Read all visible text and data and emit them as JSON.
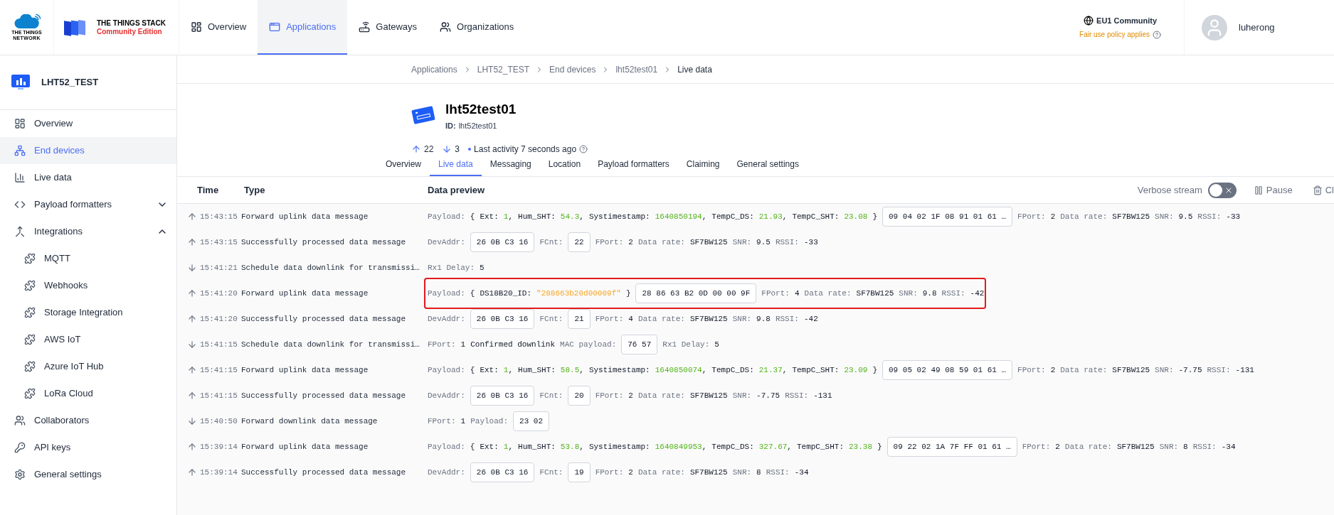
{
  "topbar": {
    "brand_line1": "THE THINGS",
    "brand_line2": "NETWORK",
    "product": "THE THINGS STACK",
    "edition": "Community Edition",
    "nav": [
      {
        "label": "Overview",
        "selected": false
      },
      {
        "label": "Applications",
        "selected": true
      },
      {
        "label": "Gateways",
        "selected": false
      },
      {
        "label": "Organizations",
        "selected": false
      }
    ],
    "cluster": "EU1 Community",
    "fair_use": "Fair use policy applies",
    "user": "luherong"
  },
  "sidebar": {
    "title": "LHT52_TEST",
    "items": [
      {
        "label": "Overview",
        "selected": false
      },
      {
        "label": "End devices",
        "selected": true
      },
      {
        "label": "Live data",
        "selected": false
      },
      {
        "label": "Payload formatters",
        "selected": false,
        "expanded": false
      },
      {
        "label": "Integrations",
        "selected": false,
        "expanded": true,
        "children": [
          {
            "label": "MQTT",
            "selected": false
          },
          {
            "label": "Webhooks",
            "selected": false
          },
          {
            "label": "Storage Integration",
            "selected": false
          },
          {
            "label": "AWS IoT",
            "selected": false
          },
          {
            "label": "Azure IoT Hub",
            "selected": false
          },
          {
            "label": "LoRa Cloud",
            "selected": false
          }
        ]
      },
      {
        "label": "Collaborators",
        "selected": false
      },
      {
        "label": "API keys",
        "selected": false
      },
      {
        "label": "General settings",
        "selected": false
      }
    ]
  },
  "breadcrumbs": [
    "Applications",
    "LHT52_TEST",
    "End devices",
    "lht52test01",
    "Live data"
  ],
  "device": {
    "name": "lht52test01",
    "id_label": "ID:",
    "id": "lht52test01",
    "uplinks": "22",
    "downlinks": "3",
    "activity": "Last activity 7 seconds ago"
  },
  "tabs": [
    {
      "label": "Overview",
      "selected": false
    },
    {
      "label": "Live data",
      "selected": true
    },
    {
      "label": "Messaging",
      "selected": false
    },
    {
      "label": "Location",
      "selected": false
    },
    {
      "label": "Payload formatters",
      "selected": false
    },
    {
      "label": "Claiming",
      "selected": false
    },
    {
      "label": "General settings",
      "selected": false
    }
  ],
  "table": {
    "columns": [
      "Time",
      "Type",
      "Data preview"
    ],
    "toolbar": {
      "verbose_label": "Verbose stream",
      "verbose_on": false,
      "pause": "Pause",
      "clear": "Cl"
    },
    "rows": [
      {
        "kind": "uplink",
        "time": "15:43:15",
        "type": "Forward uplink data message",
        "highlighted": false,
        "preview": [
          {
            "kind": "label",
            "text": "Payload:"
          },
          {
            "kind": "json",
            "open": "{",
            "close": "}",
            "fields": [
              {
                "key": "Ext:",
                "value": "1",
                "kind": "number",
                "sep": ","
              },
              {
                "key": "Hum_SHT:",
                "value": "54.3",
                "kind": "number",
                "sep": ","
              },
              {
                "key": "Systimestamp:",
                "value": "1640850194",
                "kind": "number",
                "sep": ","
              },
              {
                "key": "TempC_DS:",
                "value": "21.93",
                "kind": "number",
                "sep": ","
              },
              {
                "key": "TempC_SHT:",
                "value": "23.08",
                "kind": "number"
              }
            ]
          },
          {
            "kind": "box",
            "text": "09 04 02 1F 08 91 01 61 …"
          },
          {
            "kind": "label",
            "text": "FPort:"
          },
          {
            "kind": "value",
            "text": "2"
          },
          {
            "kind": "label",
            "text": "Data rate:"
          },
          {
            "kind": "value",
            "text": "SF7BW125"
          },
          {
            "kind": "label",
            "text": "SNR:"
          },
          {
            "kind": "value",
            "text": "9.5"
          },
          {
            "kind": "label",
            "text": "RSSI:"
          },
          {
            "kind": "value",
            "text": "-33"
          }
        ]
      },
      {
        "kind": "uplink",
        "time": "15:43:15",
        "type": "Successfully processed data message",
        "highlighted": false,
        "preview": [
          {
            "kind": "label",
            "text": "DevAddr:"
          },
          {
            "kind": "box",
            "text": "26 0B C3 16"
          },
          {
            "kind": "label",
            "text": "FCnt:"
          },
          {
            "kind": "box",
            "text": "22"
          },
          {
            "kind": "label",
            "text": "FPort:"
          },
          {
            "kind": "value",
            "text": "2"
          },
          {
            "kind": "label",
            "text": "Data rate:"
          },
          {
            "kind": "value",
            "text": "SF7BW125"
          },
          {
            "kind": "label",
            "text": "SNR:"
          },
          {
            "kind": "value",
            "text": "9.5"
          },
          {
            "kind": "label",
            "text": "RSSI:"
          },
          {
            "kind": "value",
            "text": "-33"
          }
        ]
      },
      {
        "kind": "downlink",
        "time": "15:41:21",
        "type": "Schedule data downlink for transmissi…",
        "highlighted": false,
        "preview": [
          {
            "kind": "label",
            "text": "Rx1 Delay:"
          },
          {
            "kind": "value",
            "text": "5"
          }
        ]
      },
      {
        "kind": "uplink",
        "time": "15:41:20",
        "type": "Forward uplink data message",
        "highlighted": true,
        "preview": [
          {
            "kind": "label",
            "text": "Payload:"
          },
          {
            "kind": "json",
            "open": "{",
            "close": "}",
            "fields": [
              {
                "key": "DS18B20_ID:",
                "value": "\"288663b20d00009f\"",
                "kind": "string"
              }
            ]
          },
          {
            "kind": "box",
            "text": "28 86 63 B2 0D 00 00 9F"
          },
          {
            "kind": "label",
            "text": "FPort:"
          },
          {
            "kind": "value",
            "text": "4"
          },
          {
            "kind": "label",
            "text": "Data rate:"
          },
          {
            "kind": "value",
            "text": "SF7BW125"
          },
          {
            "kind": "label",
            "text": "SNR:"
          },
          {
            "kind": "value",
            "text": "9.8"
          },
          {
            "kind": "label",
            "text": "RSSI:"
          },
          {
            "kind": "value",
            "text": "-42"
          }
        ]
      },
      {
        "kind": "uplink",
        "time": "15:41:20",
        "type": "Successfully processed data message",
        "highlighted": false,
        "preview": [
          {
            "kind": "label",
            "text": "DevAddr:"
          },
          {
            "kind": "box",
            "text": "26 0B C3 16"
          },
          {
            "kind": "label",
            "text": "FCnt:"
          },
          {
            "kind": "box",
            "text": "21"
          },
          {
            "kind": "label",
            "text": "FPort:"
          },
          {
            "kind": "value",
            "text": "4"
          },
          {
            "kind": "label",
            "text": "Data rate:"
          },
          {
            "kind": "value",
            "text": "SF7BW125"
          },
          {
            "kind": "label",
            "text": "SNR:"
          },
          {
            "kind": "value",
            "text": "9.8"
          },
          {
            "kind": "label",
            "text": "RSSI:"
          },
          {
            "kind": "value",
            "text": "-42"
          }
        ]
      },
      {
        "kind": "downlink",
        "time": "15:41:15",
        "type": "Schedule data downlink for transmissi…",
        "highlighted": false,
        "preview": [
          {
            "kind": "label",
            "text": "FPort:"
          },
          {
            "kind": "value",
            "text": "1"
          },
          {
            "kind": "value",
            "text": "Confirmed downlink"
          },
          {
            "kind": "label",
            "text": "MAC payload:"
          },
          {
            "kind": "box",
            "text": "76 57"
          },
          {
            "kind": "label",
            "text": "Rx1 Delay:"
          },
          {
            "kind": "value",
            "text": "5"
          }
        ]
      },
      {
        "kind": "uplink",
        "time": "15:41:15",
        "type": "Forward uplink data message",
        "highlighted": false,
        "preview": [
          {
            "kind": "label",
            "text": "Payload:"
          },
          {
            "kind": "json",
            "open": "{",
            "close": "}",
            "fields": [
              {
                "key": "Ext:",
                "value": "1",
                "kind": "number",
                "sep": ","
              },
              {
                "key": "Hum_SHT:",
                "value": "58.5",
                "kind": "number",
                "sep": ","
              },
              {
                "key": "Systimestamp:",
                "value": "1640850074",
                "kind": "number",
                "sep": ","
              },
              {
                "key": "TempC_DS:",
                "value": "21.37",
                "kind": "number",
                "sep": ","
              },
              {
                "key": "TempC_SHT:",
                "value": "23.09",
                "kind": "number"
              }
            ]
          },
          {
            "kind": "box",
            "text": "09 05 02 49 08 59 01 61 …"
          },
          {
            "kind": "label",
            "text": "FPort:"
          },
          {
            "kind": "value",
            "text": "2"
          },
          {
            "kind": "label",
            "text": "Data rate:"
          },
          {
            "kind": "value",
            "text": "SF7BW125"
          },
          {
            "kind": "label",
            "text": "SNR:"
          },
          {
            "kind": "value",
            "text": "-7.75"
          },
          {
            "kind": "label",
            "text": "RSSI:"
          },
          {
            "kind": "value",
            "text": "-131"
          }
        ]
      },
      {
        "kind": "uplink",
        "time": "15:41:15",
        "type": "Successfully processed data message",
        "highlighted": false,
        "preview": [
          {
            "kind": "label",
            "text": "DevAddr:"
          },
          {
            "kind": "box",
            "text": "26 0B C3 16"
          },
          {
            "kind": "label",
            "text": "FCnt:"
          },
          {
            "kind": "box",
            "text": "20"
          },
          {
            "kind": "label",
            "text": "FPort:"
          },
          {
            "kind": "value",
            "text": "2"
          },
          {
            "kind": "label",
            "text": "Data rate:"
          },
          {
            "kind": "value",
            "text": "SF7BW125"
          },
          {
            "kind": "label",
            "text": "SNR:"
          },
          {
            "kind": "value",
            "text": "-7.75"
          },
          {
            "kind": "label",
            "text": "RSSI:"
          },
          {
            "kind": "value",
            "text": "-131"
          }
        ]
      },
      {
        "kind": "downlink",
        "time": "15:40:50",
        "type": "Forward downlink data message",
        "highlighted": false,
        "preview": [
          {
            "kind": "label",
            "text": "FPort:"
          },
          {
            "kind": "value",
            "text": "1"
          },
          {
            "kind": "label",
            "text": "Payload:"
          },
          {
            "kind": "box",
            "text": "23 02"
          }
        ]
      },
      {
        "kind": "uplink",
        "time": "15:39:14",
        "type": "Forward uplink data message",
        "highlighted": false,
        "preview": [
          {
            "kind": "label",
            "text": "Payload:"
          },
          {
            "kind": "json",
            "open": "{",
            "close": "}",
            "fields": [
              {
                "key": "Ext:",
                "value": "1",
                "kind": "number",
                "sep": ","
              },
              {
                "key": "Hum_SHT:",
                "value": "53.8",
                "kind": "number",
                "sep": ","
              },
              {
                "key": "Systimestamp:",
                "value": "1640849953",
                "kind": "number",
                "sep": ","
              },
              {
                "key": "TempC_DS:",
                "value": "327.67",
                "kind": "number",
                "sep": ","
              },
              {
                "key": "TempC_SHT:",
                "value": "23.38",
                "kind": "number"
              }
            ]
          },
          {
            "kind": "box",
            "text": "09 22 02 1A 7F FF 01 61 …"
          },
          {
            "kind": "label",
            "text": "FPort:"
          },
          {
            "kind": "value",
            "text": "2"
          },
          {
            "kind": "label",
            "text": "Data rate:"
          },
          {
            "kind": "value",
            "text": "SF7BW125"
          },
          {
            "kind": "label",
            "text": "SNR:"
          },
          {
            "kind": "value",
            "text": "8"
          },
          {
            "kind": "label",
            "text": "RSSI:"
          },
          {
            "kind": "value",
            "text": "-34"
          }
        ]
      },
      {
        "kind": "uplink",
        "time": "15:39:14",
        "type": "Successfully processed data message",
        "highlighted": false,
        "preview": [
          {
            "kind": "label",
            "text": "DevAddr:"
          },
          {
            "kind": "box",
            "text": "26 0B C3 16"
          },
          {
            "kind": "label",
            "text": "FCnt:"
          },
          {
            "kind": "box",
            "text": "19"
          },
          {
            "kind": "label",
            "text": "FPort:"
          },
          {
            "kind": "value",
            "text": "2"
          },
          {
            "kind": "label",
            "text": "Data rate:"
          },
          {
            "kind": "value",
            "text": "SF7BW125"
          },
          {
            "kind": "label",
            "text": "SNR:"
          },
          {
            "kind": "value",
            "text": "8"
          },
          {
            "kind": "label",
            "text": "RSSI:"
          },
          {
            "kind": "value",
            "text": "-34"
          }
        ]
      }
    ]
  }
}
